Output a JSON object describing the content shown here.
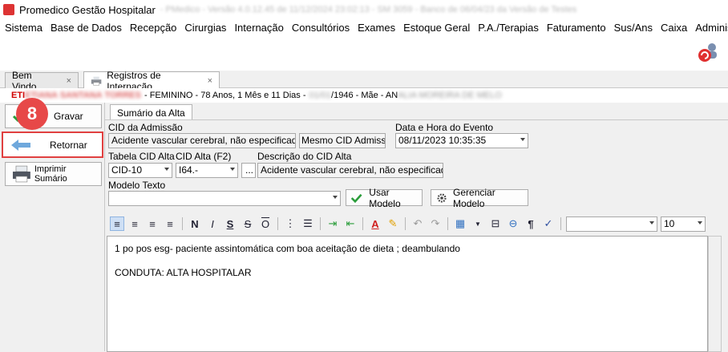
{
  "titlebar": {
    "title": "Promedico Gestão Hospitalar",
    "blurred_info": "- PMedico - Versão 4.0.12.45 de 11/12/2024 23:02:13 - SM 3059 - Banco de 06/04/23 da Versão de Testes"
  },
  "menu": [
    "Sistema",
    "Base de Dados",
    "Recepção",
    "Cirurgias",
    "Internação",
    "Consultórios",
    "Exames",
    "Estoque Geral",
    "P.A./Terapias",
    "Faturamento",
    "Sus/Ans",
    "Caixa",
    "Administração"
  ],
  "tabs": {
    "welcome": "Bem Vindo.",
    "registros": "Registros de Internação",
    "close_glyph": "×"
  },
  "patient": {
    "name_prefix": "ETI",
    "name_blurred": "ETIANA SANTANA TORRES",
    "info": "- FEMININO - 78 Anos, 1 Mês e 11 Dias -",
    "date_blurred": "01/01",
    "info2": "/1946 - Mãe - AN",
    "mother_blurred": "ALIA MOREIRA DE MELO"
  },
  "sidebar": {
    "gravar": "Gravar",
    "retornar": "Retornar",
    "imprimir": "Imprimir Sumário",
    "step_badge": "8"
  },
  "form": {
    "subtab": "Sumário da Alta",
    "cid_admissao_label": "CID da Admissão",
    "cid_admissao_value": "Acidente vascular cerebral, não especificado como",
    "mesmo_cid_button": "Mesmo CID Admissão",
    "data_hora_label": "Data e Hora do Evento",
    "data_hora_value": "08/11/2023 10:35:35",
    "tabela_cid_label": "Tabela CID Alta",
    "tabela_cid_value": "CID-10",
    "cid_alta_label": "CID Alta (F2)",
    "cid_alta_value": "I64.-",
    "ellipsis_button": "...",
    "descricao_label": "Descrição do CID Alta",
    "descricao_value": "Acidente vascular cerebral, não especificado como",
    "modelo_label": "Modelo Texto",
    "modelo_value": "",
    "usar_modelo_button": "Usar Modelo",
    "gerenciar_modelo_button": "Gerenciar Modelo"
  },
  "toolbar": {
    "bold": "N",
    "italic": "I",
    "underline": "S",
    "strike": "S",
    "overline": "O",
    "pilcrow": "¶",
    "font_name": "",
    "font_size": "10"
  },
  "editor": {
    "line1": "1 po pos esg- paciente assintomática com boa aceitação de dieta ; deambulando",
    "line2": "",
    "line3": "CONDUTA: ALTA HOSPITALAR"
  },
  "colors": {
    "badge": "#e74848",
    "highlight": "#e04040",
    "patient_name": "#d00000"
  }
}
